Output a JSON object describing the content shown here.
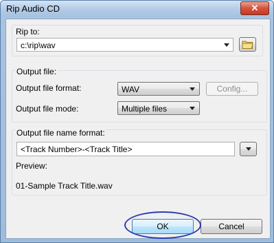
{
  "window": {
    "title": "Rip Audio CD",
    "close_glyph": "✕"
  },
  "rip_to": {
    "label": "Rip to:",
    "path_value": "c:\\rip\\wav",
    "browse_icon": "folder-icon"
  },
  "output_file": {
    "group_label": "Output file:",
    "format_label": "Output file format:",
    "format_value": "WAV",
    "config_label": "Config...",
    "mode_label": "Output file mode:",
    "mode_value": "Multiple files"
  },
  "name_format": {
    "group_label": "Output file name format:",
    "value": "<Track Number>-<Track Title>",
    "preview_label": "Preview:",
    "preview_value": "01-Sample Track Title.wav"
  },
  "buttons": {
    "ok": "OK",
    "cancel": "Cancel"
  },
  "colors": {
    "annotation_circle": "#2a3cb0",
    "title_bar": "#b3cce7",
    "close_button": "#d5533c"
  }
}
